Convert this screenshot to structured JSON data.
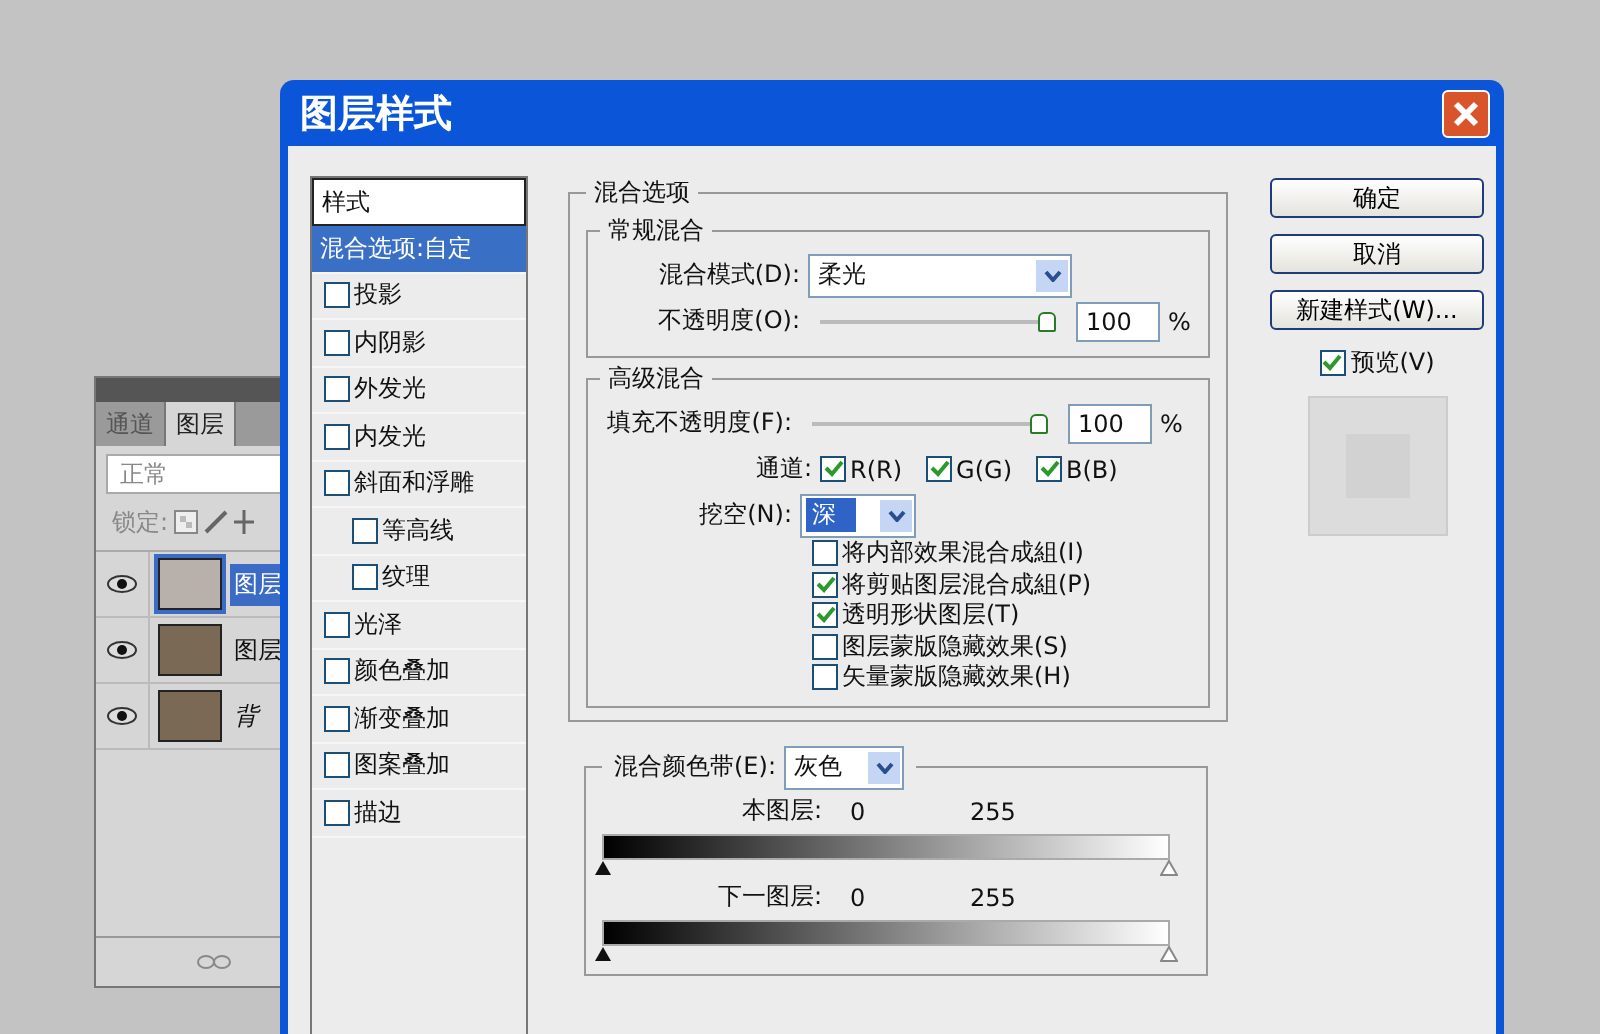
{
  "layers_panel": {
    "tabs": [
      {
        "label": "通道",
        "selected": false
      },
      {
        "label": "图层",
        "selected": true
      }
    ],
    "blend_mode": "正常",
    "lock_label": "锁定:",
    "layers": [
      {
        "name": "图层",
        "visible": true,
        "selected": true,
        "kind": "fill",
        "italic": false
      },
      {
        "name": "图层",
        "visible": true,
        "selected": false,
        "kind": "photo",
        "italic": false
      },
      {
        "name": "背",
        "visible": true,
        "selected": false,
        "kind": "photo",
        "italic": true
      }
    ]
  },
  "dialog": {
    "title": "图层样式",
    "styles_list": {
      "header": "样式",
      "items": [
        {
          "label": "混合选项:自定",
          "kind": "heading",
          "selected": true
        },
        {
          "label": "投影",
          "kind": "checkbox",
          "checked": false,
          "selected": false
        },
        {
          "label": "内阴影",
          "kind": "checkbox",
          "checked": false,
          "selected": false
        },
        {
          "label": "外发光",
          "kind": "checkbox",
          "checked": false,
          "selected": false
        },
        {
          "label": "内发光",
          "kind": "checkbox",
          "checked": false,
          "selected": false
        },
        {
          "label": "斜面和浮雕",
          "kind": "checkbox",
          "checked": false,
          "selected": false,
          "children": [
            {
              "label": "等高线",
              "kind": "checkbox",
              "checked": false,
              "selected": false
            },
            {
              "label": "纹理",
              "kind": "checkbox",
              "checked": false,
              "selected": false
            }
          ]
        },
        {
          "label": "光泽",
          "kind": "checkbox",
          "checked": false,
          "selected": false
        },
        {
          "label": "颜色叠加",
          "kind": "checkbox",
          "checked": false,
          "selected": false
        },
        {
          "label": "渐变叠加",
          "kind": "checkbox",
          "checked": false,
          "selected": false
        },
        {
          "label": "图案叠加",
          "kind": "checkbox",
          "checked": false,
          "selected": false
        },
        {
          "label": "描边",
          "kind": "checkbox",
          "checked": false,
          "selected": false
        }
      ]
    },
    "blending_options": {
      "title": "混合选项",
      "general": {
        "title": "常规混合",
        "mode_label": "混合模式(D):",
        "mode": "柔光",
        "opacity_label": "不透明度(O):",
        "opacity_slider": {
          "level": 1
        },
        "opacity_value": "100",
        "percent": "%"
      },
      "advanced": {
        "title": "高级混合",
        "fill_label": "填充不透明度(F):",
        "fill_slider": {
          "level": 1
        },
        "fill_value": "100",
        "percent": "%",
        "channels_label": "通道:",
        "channels": [
          {
            "label": "R(R)",
            "checked": true
          },
          {
            "label": "G(G)",
            "checked": true
          },
          {
            "label": "B(B)",
            "checked": true
          }
        ],
        "knockout_label": "挖空(N):",
        "knockout": "深",
        "options": [
          {
            "label": "将内部效果混合成組(I)",
            "checked": false
          },
          {
            "label": "将剪贴图层混合成組(P)",
            "checked": true
          },
          {
            "label": "透明形状图层(T)",
            "checked": true
          },
          {
            "label": "图层蒙版隐藏效果(S)",
            "checked": false
          },
          {
            "label": "矢量蒙版隐藏效果(H)",
            "checked": false
          }
        ]
      },
      "blend_if": {
        "label": "混合颜色带(E):",
        "value": "灰色",
        "bands": [
          {
            "label": "本图层:",
            "low": "0",
            "high": "255"
          },
          {
            "label": "下一图层:",
            "low": "0",
            "high": "255"
          }
        ]
      }
    },
    "buttons": [
      {
        "label": "确定"
      },
      {
        "label": "取消"
      },
      {
        "label": "新建样式(W)..."
      }
    ],
    "preview": {
      "label": "预览(V)",
      "checked": true
    }
  }
}
